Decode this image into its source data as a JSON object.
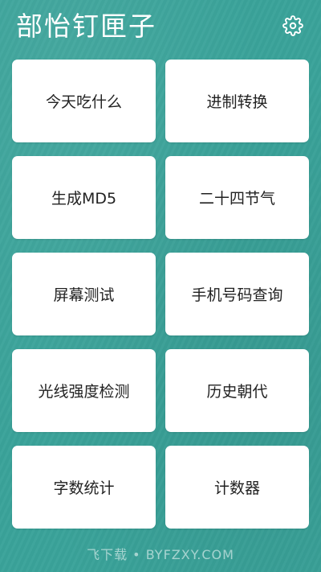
{
  "app": {
    "title": "部怡钉匣子"
  },
  "header": {
    "settings_icon": "gear-icon"
  },
  "tools": [
    {
      "label": "今天吃什么",
      "name": "tool-what-to-eat"
    },
    {
      "label": "进制转换",
      "name": "tool-base-conversion"
    },
    {
      "label": "生成MD5",
      "name": "tool-md5"
    },
    {
      "label": "二十四节气",
      "name": "tool-solar-terms"
    },
    {
      "label": "屏幕测试",
      "name": "tool-screen-test"
    },
    {
      "label": "手机号码查询",
      "name": "tool-phone-lookup"
    },
    {
      "label": "光线强度检测",
      "name": "tool-light-meter"
    },
    {
      "label": "历史朝代",
      "name": "tool-dynasties"
    },
    {
      "label": "字数统计",
      "name": "tool-word-count"
    },
    {
      "label": "计数器",
      "name": "tool-counter"
    }
  ],
  "watermark": "飞下载 • BYFZXY.COM",
  "colors": {
    "background": "#3aa39a",
    "tile": "#ffffff",
    "text": "#222222"
  }
}
